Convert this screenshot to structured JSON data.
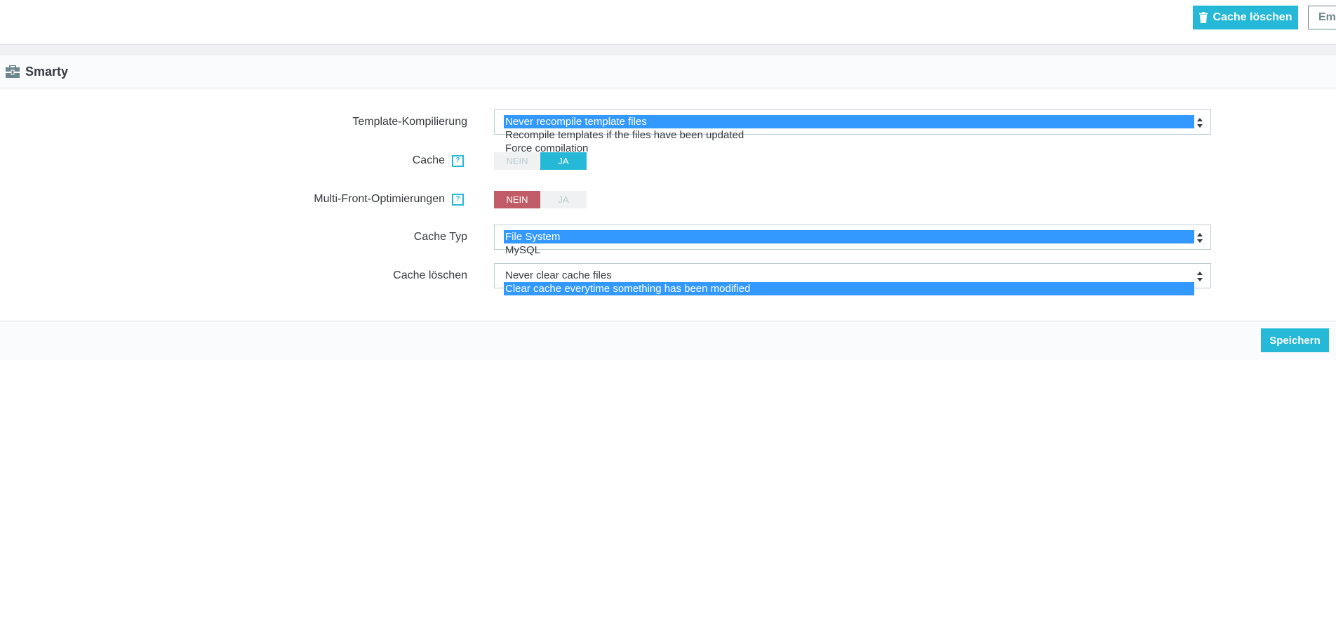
{
  "toolbar": {
    "clear_cache_label": "Cache löschen",
    "secondary_label": "Emp"
  },
  "panel": {
    "title": "Smarty",
    "icon": "toolbox-icon",
    "save_label": "Speichern"
  },
  "fields": {
    "template_compilation": {
      "label": "Template-Kompilierung",
      "options": [
        "Never recompile template files",
        "Recompile templates if the files have been updated",
        "Force compilation"
      ],
      "selected": "Never recompile template files"
    },
    "cache": {
      "label": "Cache",
      "no_label": "NEIN",
      "yes_label": "JA",
      "value": "JA"
    },
    "multi_front": {
      "label": "Multi-Front-Optimierungen",
      "no_label": "NEIN",
      "yes_label": "JA",
      "value": "NEIN"
    },
    "cache_type": {
      "label": "Cache Typ",
      "options": [
        "File System",
        "MySQL"
      ],
      "selected": "File System"
    },
    "clear_cache": {
      "label": "Cache löschen",
      "options": [
        "Never clear cache files",
        "Clear cache everytime something has been modified"
      ],
      "selected": "Clear cache everytime something has been modified"
    }
  },
  "colors": {
    "accent": "#25b9d7",
    "danger": "#c05c67",
    "selection": "#3399ff"
  }
}
